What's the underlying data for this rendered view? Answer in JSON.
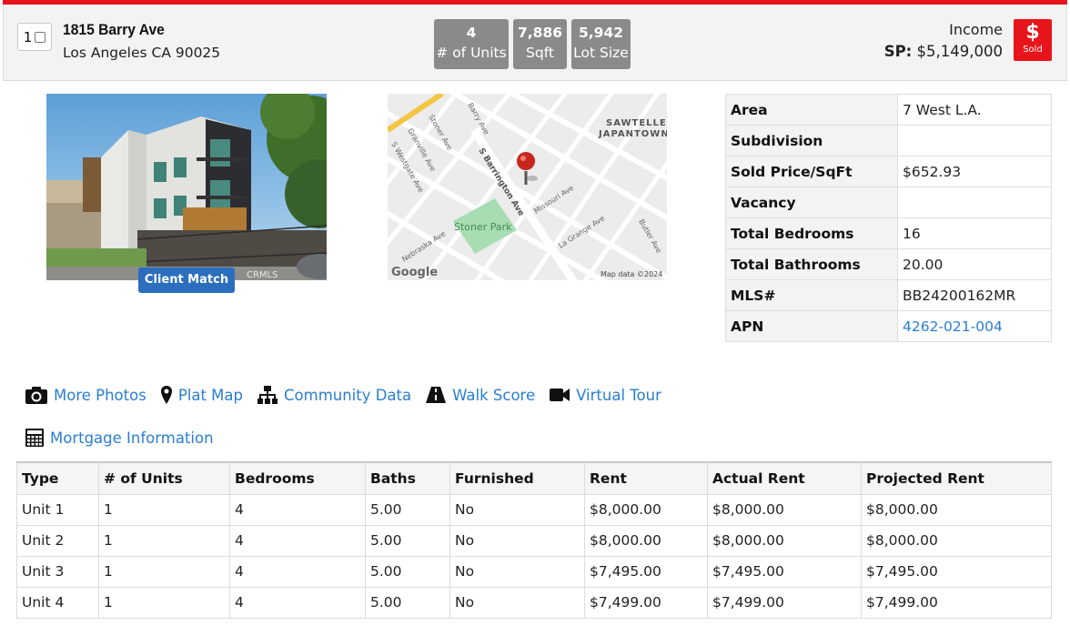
{
  "header": {
    "index": "1",
    "address_line1": "1815 Barry Ave",
    "address_line2": "Los Angeles CA 90025",
    "stats": [
      {
        "value": "4",
        "label": "# of Units"
      },
      {
        "value": "7,886",
        "label": "Sqft"
      },
      {
        "value": "5,942",
        "label": "Lot Size"
      }
    ],
    "type": "Income",
    "sp_label": "SP:",
    "sp_value": "$5,149,000",
    "status_symbol": "$",
    "status": "Sold"
  },
  "photo": {
    "button_label": "Client Match",
    "watermark": "CRMLS"
  },
  "map": {
    "labels": {
      "neighborhood1": "SAWTELLE",
      "neighborhood2": "JAPANTOWN",
      "street_barry": "Barry Ave",
      "street_stoner": "Stoner Ave",
      "street_granville": "Granville Ave",
      "street_westgate": "S Westgate Ave",
      "street_barrington": "S Barrington Ave",
      "street_missouri": "Missouri Ave",
      "street_nebraska": "Nebraska Ave",
      "street_lagrange": "La Grange Ave",
      "street_butler": "Butler Ave",
      "park": "Stoner Park",
      "logo": "Google",
      "credit": "Map data ©2024"
    }
  },
  "details": [
    {
      "label": "Area",
      "value": "7 West L.A."
    },
    {
      "label": "Subdivision",
      "value": ""
    },
    {
      "label": "Sold Price/SqFt",
      "value": "$652.93"
    },
    {
      "label": "Vacancy",
      "value": ""
    },
    {
      "label": "Total Bedrooms",
      "value": "16"
    },
    {
      "label": "Total Bathrooms",
      "value": "20.00"
    },
    {
      "label": "MLS#",
      "value": "BB24200162MR"
    },
    {
      "label": "APN",
      "value": "4262-021-004"
    }
  ],
  "links": {
    "more_photos": "More Photos",
    "plat_map": "Plat Map",
    "community_data": "Community Data",
    "walk_score": "Walk Score",
    "virtual_tour": "Virtual Tour",
    "mortgage": "Mortgage Information"
  },
  "units_table": {
    "headers": [
      "Type",
      "# of Units",
      "Bedrooms",
      "Baths",
      "Furnished",
      "Rent",
      "Actual Rent",
      "Projected Rent"
    ],
    "rows": [
      [
        "Unit 1",
        "1",
        "4",
        "5.00",
        "No",
        "$8,000.00",
        "$8,000.00",
        "$8,000.00"
      ],
      [
        "Unit 2",
        "1",
        "4",
        "5.00",
        "No",
        "$8,000.00",
        "$8,000.00",
        "$8,000.00"
      ],
      [
        "Unit 3",
        "1",
        "4",
        "5.00",
        "No",
        "$7,495.00",
        "$7,495.00",
        "$7,495.00"
      ],
      [
        "Unit 4",
        "1",
        "4",
        "5.00",
        "No",
        "$7,499.00",
        "$7,499.00",
        "$7,499.00"
      ]
    ]
  },
  "colors": {
    "accent_red": "#e8141b",
    "link_blue": "#2a7ed2",
    "button_blue": "#2a6ebd",
    "stat_gray": "#8a8a8a"
  }
}
